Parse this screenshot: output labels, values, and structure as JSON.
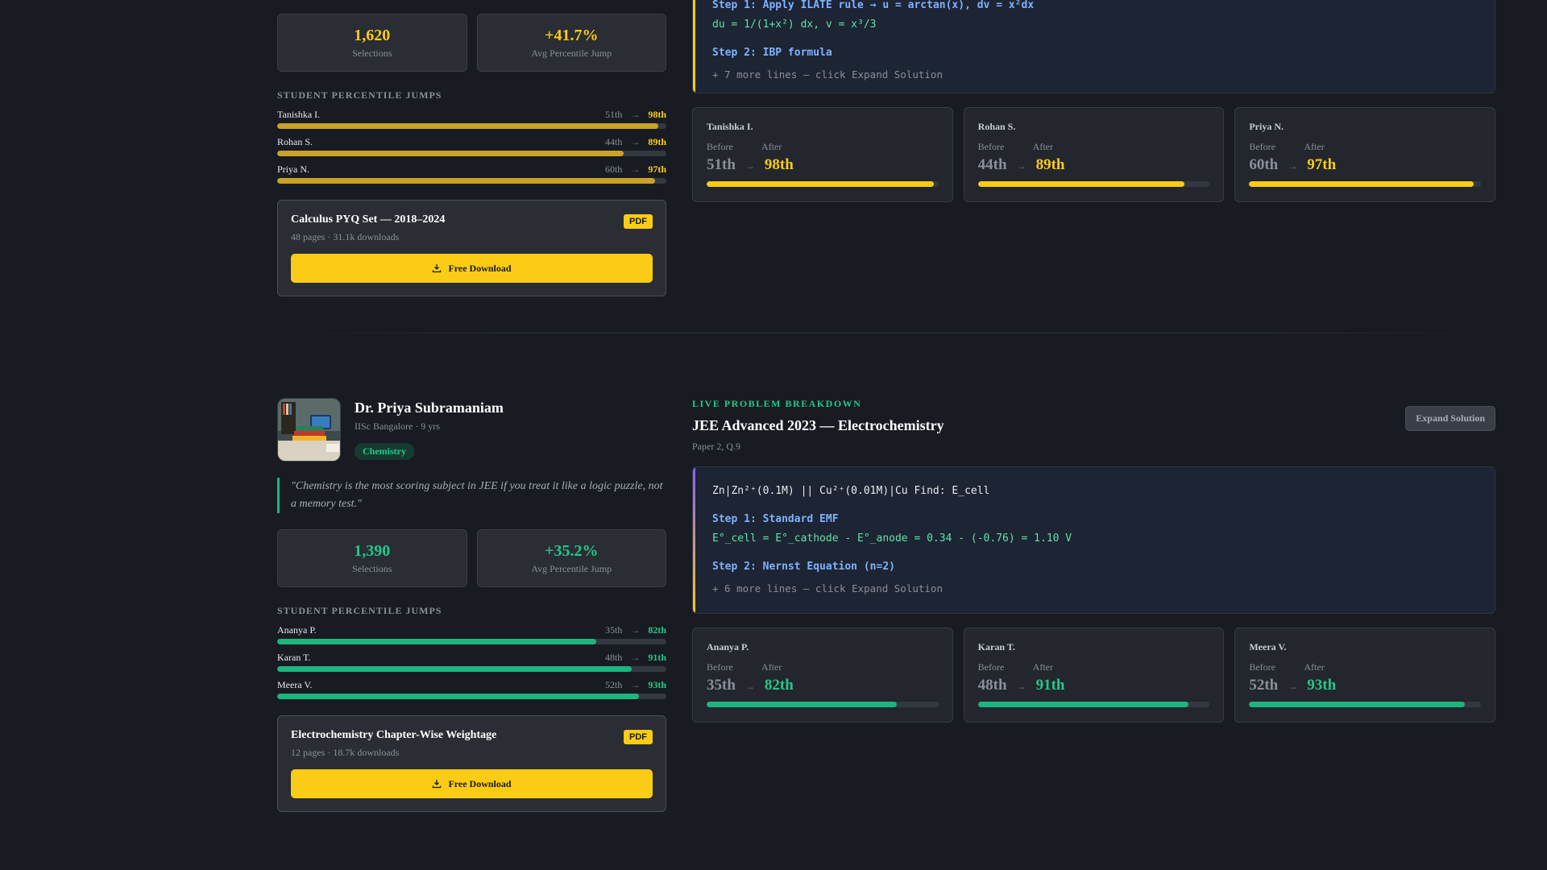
{
  "colors": {
    "gold": "#facc15",
    "green": "#1db47e",
    "gold_bar": "#c9a227",
    "purple": "#8b5cf6"
  },
  "top": {
    "stats": [
      {
        "value": "1,620",
        "label": "Selections"
      },
      {
        "value": "+41.7%",
        "label": "Avg Percentile Jump"
      }
    ],
    "jumps_title": "STUDENT PERCENTILE JUMPS",
    "jumps": [
      {
        "name": "Tanishka I.",
        "before": "51th",
        "arrow": "→",
        "after": "98th",
        "progress": 0.98
      },
      {
        "name": "Rohan S.",
        "before": "44th",
        "arrow": "→",
        "after": "89th",
        "progress": 0.89
      },
      {
        "name": "Priya N.",
        "before": "60th",
        "arrow": "→",
        "after": "97th",
        "progress": 0.97
      }
    ],
    "resource": {
      "title": "Calculus PYQ Set — 2018–2024",
      "meta": "48 pages · 31.1k downloads",
      "badge": "PDF",
      "button": "Free Download"
    },
    "code": {
      "line1": "Step 1: Apply ILATE rule → u = arctan(x), dv = x²dx",
      "line2": "du = 1/(1+x²) dx, v = x³/3",
      "step2": "Step 2: IBP formula",
      "more": "+ 7 more lines — click Expand Solution"
    },
    "cards": [
      {
        "name": "Tanishka I.",
        "before_label": "Before",
        "after_label": "After",
        "before": "51th",
        "after": "98th",
        "progress": 0.98
      },
      {
        "name": "Rohan S.",
        "before_label": "Before",
        "after_label": "After",
        "before": "44th",
        "after": "89th",
        "progress": 0.89
      },
      {
        "name": "Priya N.",
        "before_label": "Before",
        "after_label": "After",
        "before": "60th",
        "after": "97th",
        "progress": 0.97
      }
    ]
  },
  "bottom": {
    "mentor": {
      "name": "Dr. Priya Subramaniam",
      "meta": "IISc Bangalore · 9 yrs",
      "subject": "Chemistry",
      "quote": "\"Chemistry is the most scoring subject in JEE if you treat it like a logic puzzle, not a memory test.\""
    },
    "stats": [
      {
        "value": "1,390",
        "label": "Selections"
      },
      {
        "value": "+35.2%",
        "label": "Avg Percentile Jump"
      }
    ],
    "jumps_title": "STUDENT PERCENTILE JUMPS",
    "jumps": [
      {
        "name": "Ananya P.",
        "before": "35th",
        "arrow": "→",
        "after": "82th",
        "progress": 0.82
      },
      {
        "name": "Karan T.",
        "before": "48th",
        "arrow": "→",
        "after": "91th",
        "progress": 0.91
      },
      {
        "name": "Meera V.",
        "before": "52th",
        "arrow": "→",
        "after": "93th",
        "progress": 0.93
      }
    ],
    "resource": {
      "title": "Electrochemistry Chapter-Wise Weightage",
      "meta": "12 pages · 18.7k downloads",
      "badge": "PDF",
      "button": "Free Download"
    },
    "problem": {
      "label": "LIVE PROBLEM BREAKDOWN",
      "title": "JEE Advanced 2023 — Electrochemistry",
      "meta": "Paper 2, Q.9",
      "expand": "Expand Solution"
    },
    "code": {
      "line0": "Zn|Zn²⁺(0.1M) || Cu²⁺(0.01M)|Cu Find: E_cell",
      "step1": "Step 1: Standard EMF",
      "line1": "E°_cell = E°_cathode - E°_anode = 0.34 - (-0.76) = 1.10 V",
      "step2": "Step 2: Nernst Equation (n=2)",
      "more": "+ 6 more lines — click Expand Solution"
    },
    "cards": [
      {
        "name": "Ananya P.",
        "before_label": "Before",
        "after_label": "After",
        "before": "35th",
        "after": "82th",
        "progress": 0.82
      },
      {
        "name": "Karan T.",
        "before_label": "Before",
        "after_label": "After",
        "before": "48th",
        "after": "91th",
        "progress": 0.91
      },
      {
        "name": "Meera V.",
        "before_label": "Before",
        "after_label": "After",
        "before": "52th",
        "after": "93th",
        "progress": 0.93
      }
    ]
  }
}
